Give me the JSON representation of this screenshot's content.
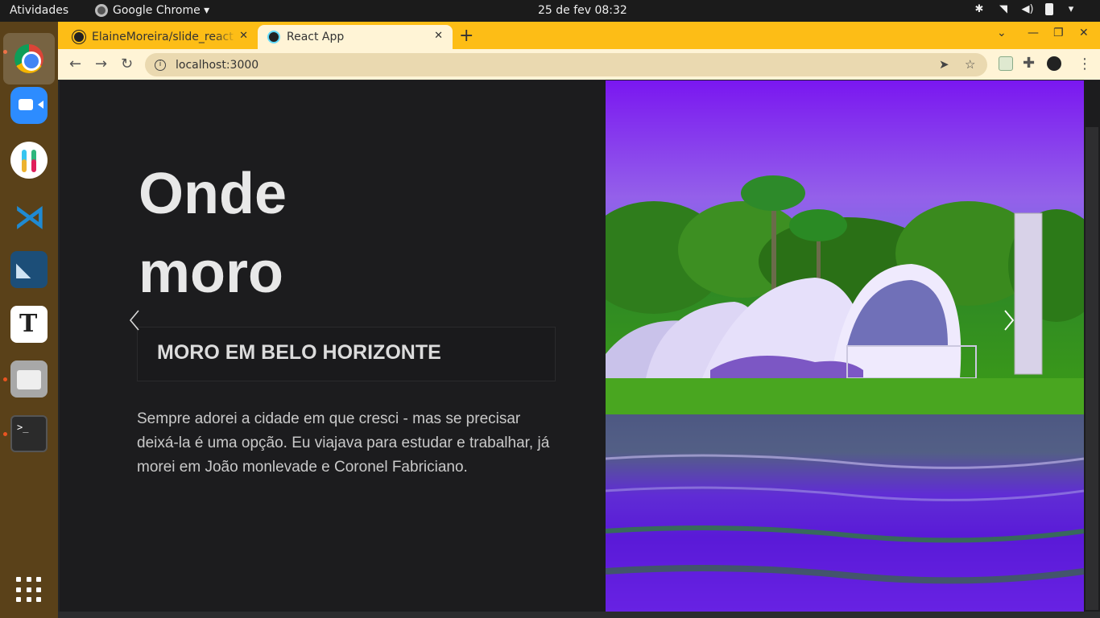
{
  "topbar": {
    "activities": "Atividades",
    "app_name": "Google Chrome ▾",
    "clock": "25 de fev  08:32"
  },
  "browser": {
    "tabs": [
      {
        "title": "ElaineMoreira/slide_react",
        "icon": "github-icon",
        "active": false
      },
      {
        "title": "React App",
        "icon": "react-icon",
        "active": true
      }
    ],
    "url": "localhost:3000",
    "tab_close": "✕",
    "new_tab": "+"
  },
  "slide": {
    "heading_line1": "Onde",
    "heading_line2": "moro",
    "caption": "MORO EM BELO HORIZONTE",
    "paragraph": "Sempre adorei a cidade em que cresci - mas se precisar deixá-la é uma opção. Eu viajava para estudar e trabalhar, já morei em João monlevade e Coronel Fabriciano."
  },
  "colors": {
    "tabstrip": "#fdbd16",
    "toolbar": "#fff4d6",
    "page_bg": "#1c1c1e",
    "dock": "#5a4119",
    "accent_dot": "#e95420"
  }
}
